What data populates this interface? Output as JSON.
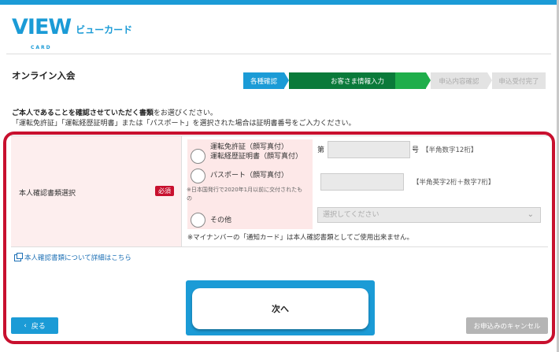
{
  "brand": {
    "logo_mark": "VIEW",
    "logo_sub": "CARD",
    "logo_text": "ビューカード",
    "accent": "#1b9bd6",
    "required_color": "#c8102e"
  },
  "page": {
    "title": "オンライン入会"
  },
  "steps": [
    {
      "label": "各種確認",
      "state": "done"
    },
    {
      "label": "お客さま情報入力",
      "state": "current"
    },
    {
      "label": "申込内容確認",
      "state": "pending"
    },
    {
      "label": "申込受付完了",
      "state": "pending"
    }
  ],
  "intro": {
    "bold": "ご本人であることを確認させていただく書類",
    "line1_rest": "をお選びください。",
    "line2": "「運転免許証」「運転経歴証明書」または「パスポート」を選択された場合は証明書番号をご入力ください。"
  },
  "form": {
    "label": "本人確認書類選択",
    "required": "必須",
    "options": {
      "license_line1": "運転免許証（顔写真付）",
      "license_line2": "運転経歴証明書（顔写真付）",
      "passport": "パスポート（顔写真付）",
      "passport_note_1": "※日本国発行で2020年1月以前に交付されたも",
      "passport_note_2": "の",
      "other": "その他"
    },
    "license_prefix": "第",
    "license_suffix": "号",
    "license_hint": "【半角数字12桁】",
    "passport_hint": "【半角英字2桁＋数字7桁】",
    "select_placeholder": "選択してください",
    "mynumber_note": "※マイナンバーの「通知カード」は本人確認書類としてご使用出来ません。"
  },
  "detail_link": "本人確認書類について詳細はこちら",
  "buttons": {
    "next": "次へ",
    "back": "戻る",
    "cancel": "お申込みのキャンセル"
  },
  "icons": {
    "back": "chevron-left-icon",
    "select": "chevron-down-icon",
    "link": "external-window-icon"
  }
}
